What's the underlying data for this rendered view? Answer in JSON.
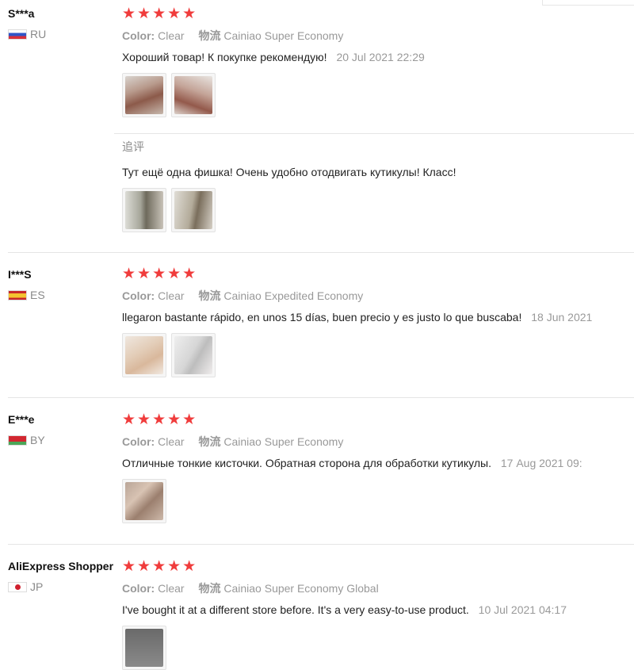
{
  "labels": {
    "color_key": "Color:",
    "shipping_key": "物流",
    "append_label": "追评"
  },
  "colors": {
    "star": "#f03c3c",
    "muted_text": "#999999",
    "divider": "#e5e5e5"
  },
  "feedbacks": [
    {
      "user": "S***a",
      "country": "RU",
      "flag": "russia-flag-icon",
      "stars": "★★★★★",
      "rating": 5,
      "color": "Clear",
      "shipping": "Cainiao Super Economy",
      "text": "Хороший товар! К покупке рекомендую!",
      "date": "20 Jul 2021 22:29",
      "photos": [
        "review-photo-brushes-in-hand",
        "review-photo-brushes-in-package"
      ],
      "append": {
        "text": "Тут ещё одна фишка! Очень удобно отодвигать кутикулы! Класс!",
        "photos": [
          "review-photo-brush-detail",
          "review-photo-brush-tips"
        ]
      }
    },
    {
      "user": "I***S",
      "country": "ES",
      "flag": "spain-flag-icon",
      "stars": "★★★★★",
      "rating": 5,
      "color": "Clear",
      "shipping": "Cainiao Expedited Economy",
      "text": "llegaron bastante rápido, en unos 15 días, buen precio y es justo lo que buscaba!",
      "date": "18 Jun 2021",
      "photos": [
        "review-photo-brushes-on-table",
        "review-photo-brushes-closeup"
      ]
    },
    {
      "user": "E***e",
      "country": "BY",
      "flag": "belarus-flag-icon",
      "stars": "★★★★★",
      "rating": 5,
      "color": "Clear",
      "shipping": "Cainiao Super Economy",
      "text": "Отличные тонкие кисточки. Обратная сторона для обработки кутикулы.",
      "date": "17 Aug 2021 09:",
      "photos": [
        "review-photo-brushes-held"
      ]
    },
    {
      "user": "AliExpress Shopper",
      "country": "JP",
      "flag": "japan-flag-icon",
      "stars": "★★★★★",
      "rating": 5,
      "color": "Clear",
      "shipping": "Cainiao Super Economy Global",
      "text": "I've bought it at a different store before. It's a very easy-to-use product.",
      "date": "10 Jul 2021 04:17",
      "photos": [
        "review-photo-partial"
      ]
    }
  ]
}
